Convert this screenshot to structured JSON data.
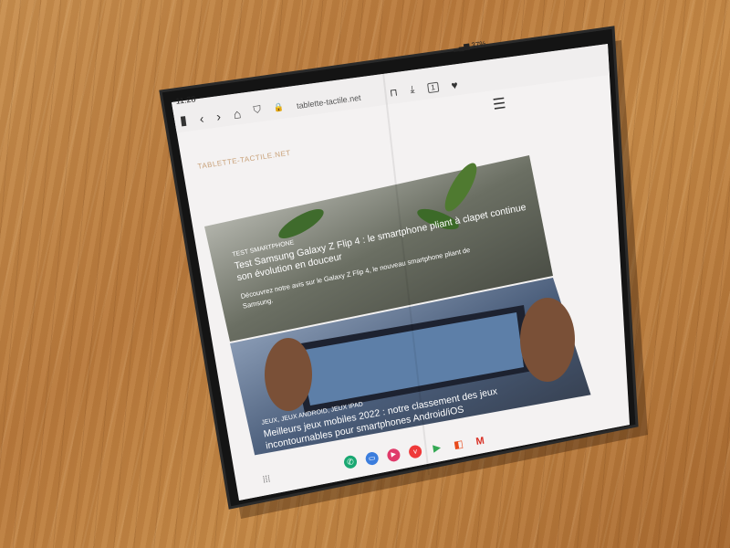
{
  "status": {
    "time": "11:28",
    "battery": "37%"
  },
  "browser": {
    "url": "tablette-tactile.net",
    "tab_count": "1"
  },
  "site": {
    "brand": "TABLETTE-TACTILE.NET"
  },
  "articles": [
    {
      "category": "TEST SMARTPHONE",
      "title_line1": "Test Samsung Galaxy Z Flip 4 : le smartphone pliant à clapet continue",
      "title_line2": "son évolution en douceur",
      "desc_line1": "Découvrez notre avis sur le Galaxy Z Flip 4, le nouveau smartphone pliant de",
      "desc_line2": "Samsung."
    },
    {
      "category": "JEUX, JEUX ANDROID, JEUX IPAD",
      "title_line1": "Meilleurs jeux mobiles 2022 : notre classement des jeux",
      "title_line2": "incontournables pour smartphones Android/iOS"
    }
  ],
  "dock": [
    "phone-app",
    "messages-app",
    "youtube-app",
    "vivaldi-app",
    "play-store-app",
    "office-app",
    "gmail-app"
  ]
}
